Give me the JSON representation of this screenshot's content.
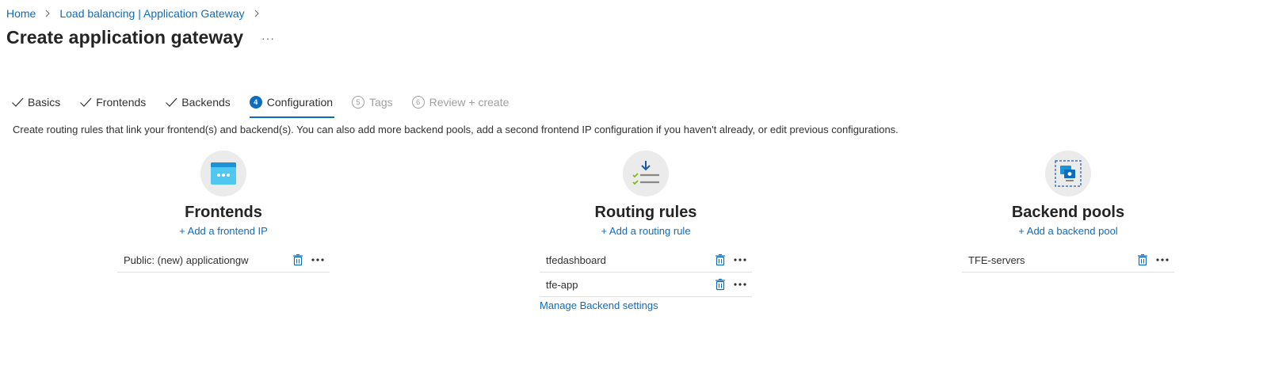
{
  "breadcrumb": {
    "items": [
      {
        "label": "Home"
      },
      {
        "label": "Load balancing | Application Gateway"
      }
    ]
  },
  "header": {
    "title": "Create application gateway",
    "more": "···"
  },
  "tabs": [
    {
      "label": "Basics",
      "state": "completed"
    },
    {
      "label": "Frontends",
      "state": "completed"
    },
    {
      "label": "Backends",
      "state": "completed"
    },
    {
      "label": "Configuration",
      "number": "4",
      "state": "current"
    },
    {
      "label": "Tags",
      "number": "5",
      "state": "disabled"
    },
    {
      "label": "Review + create",
      "number": "6",
      "state": "disabled"
    }
  ],
  "description": "Create routing rules that link your frontend(s) and backend(s). You can also add more backend pools, add a second frontend IP configuration if you haven't already, or edit previous configurations.",
  "frontends": {
    "title": "Frontends",
    "add_label": "+ Add a frontend IP",
    "items": [
      {
        "label": "Public: (new) applicationgw"
      }
    ]
  },
  "routing_rules": {
    "title": "Routing rules",
    "add_label": "+ Add a routing rule",
    "items": [
      {
        "label": "tfedashboard"
      },
      {
        "label": "tfe-app"
      }
    ],
    "manage_label": "Manage Backend settings"
  },
  "backend_pools": {
    "title": "Backend pools",
    "add_label": "+ Add a backend pool",
    "items": [
      {
        "label": "TFE-servers"
      }
    ]
  },
  "colors": {
    "accent": "#0f6cbd",
    "icon_circle": "#ebebeb",
    "divider": "#e1dfdd"
  }
}
